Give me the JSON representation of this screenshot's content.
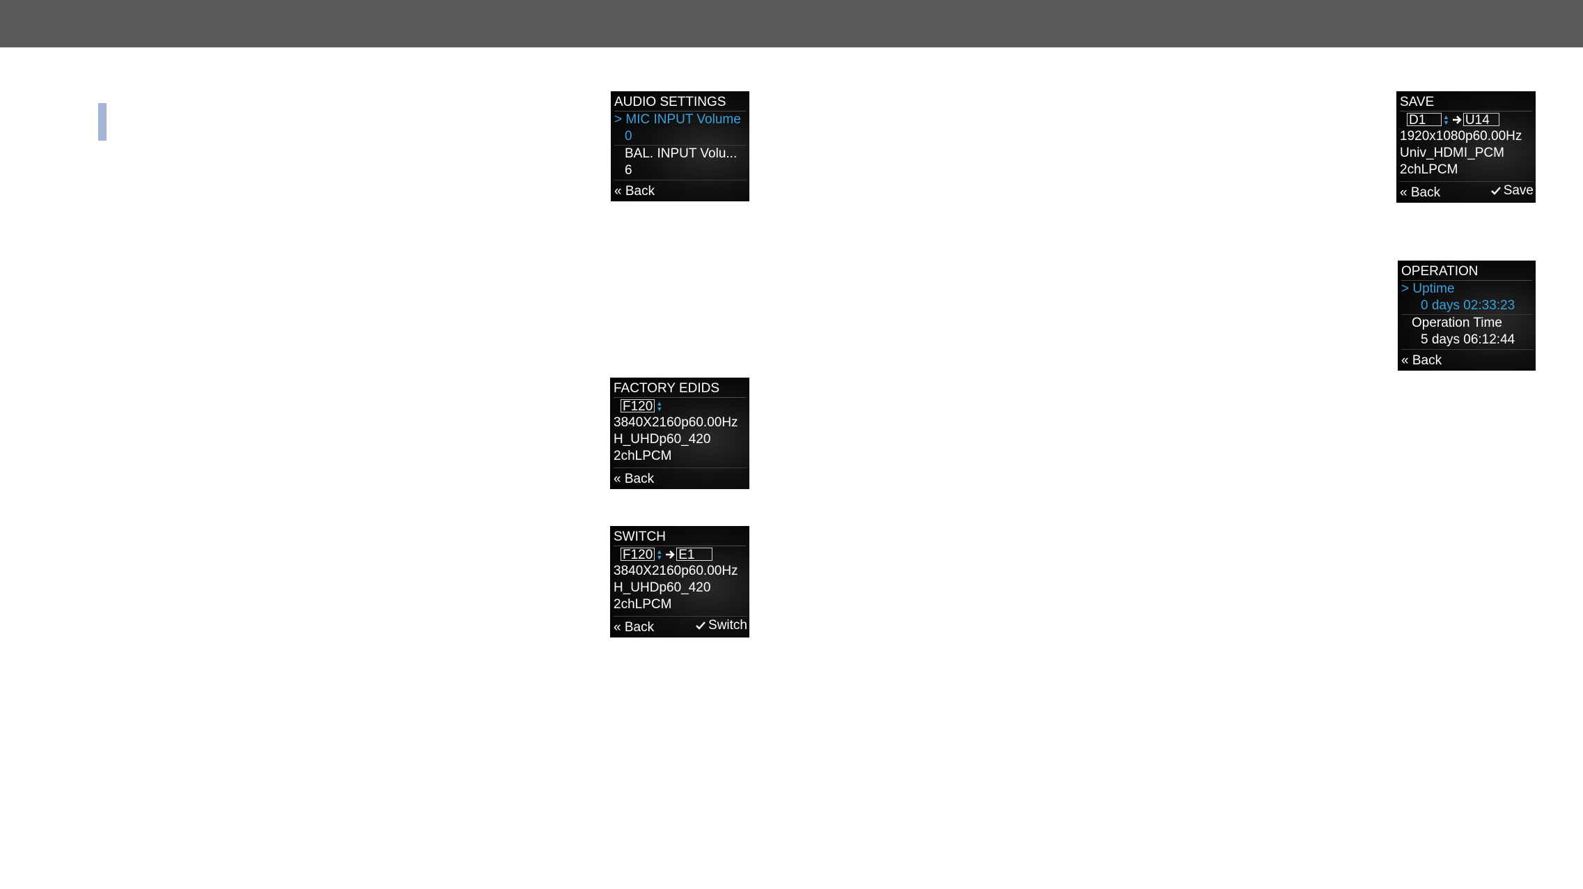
{
  "audio": {
    "title": "AUDIO SETTINGS",
    "item1_marker": ">",
    "item1_label": "MIC INPUT Volume",
    "item1_value": "0",
    "item2_label": "BAL. INPUT Volu...",
    "item2_value": "6",
    "back_label": "« Back"
  },
  "factory": {
    "title": "FACTORY EDIDS",
    "edid": "F120",
    "line1": "3840X2160p60.00Hz",
    "line2": "H_UHDp60_420",
    "line3": "2chLPCM",
    "back_label": "« Back"
  },
  "switch": {
    "title": "SWITCH",
    "source": "F120",
    "dest": "E1",
    "line1": "3840X2160p60.00Hz",
    "line2": "H_UHDp60_420",
    "line3": "2chLPCM",
    "back_label": "« Back",
    "action_label": "Switch"
  },
  "save": {
    "title": "SAVE",
    "source": "D1",
    "dest": "U14",
    "line1": "1920x1080p60.00Hz",
    "line2": "Univ_HDMI_PCM",
    "line3": "2chLPCM",
    "back_label": "« Back",
    "action_label": "Save"
  },
  "operation": {
    "title": "OPERATION",
    "item1_marker": ">",
    "item1_label": "Uptime",
    "item1_value": "0 days 02:33:23",
    "item2_label": "Operation Time",
    "item2_value": "5 days 06:12:44",
    "back_label": "« Back"
  },
  "colors": {
    "topbar": "#5b5b5b",
    "marker": "#a4b3d6",
    "selected": "#3aa0dc"
  }
}
